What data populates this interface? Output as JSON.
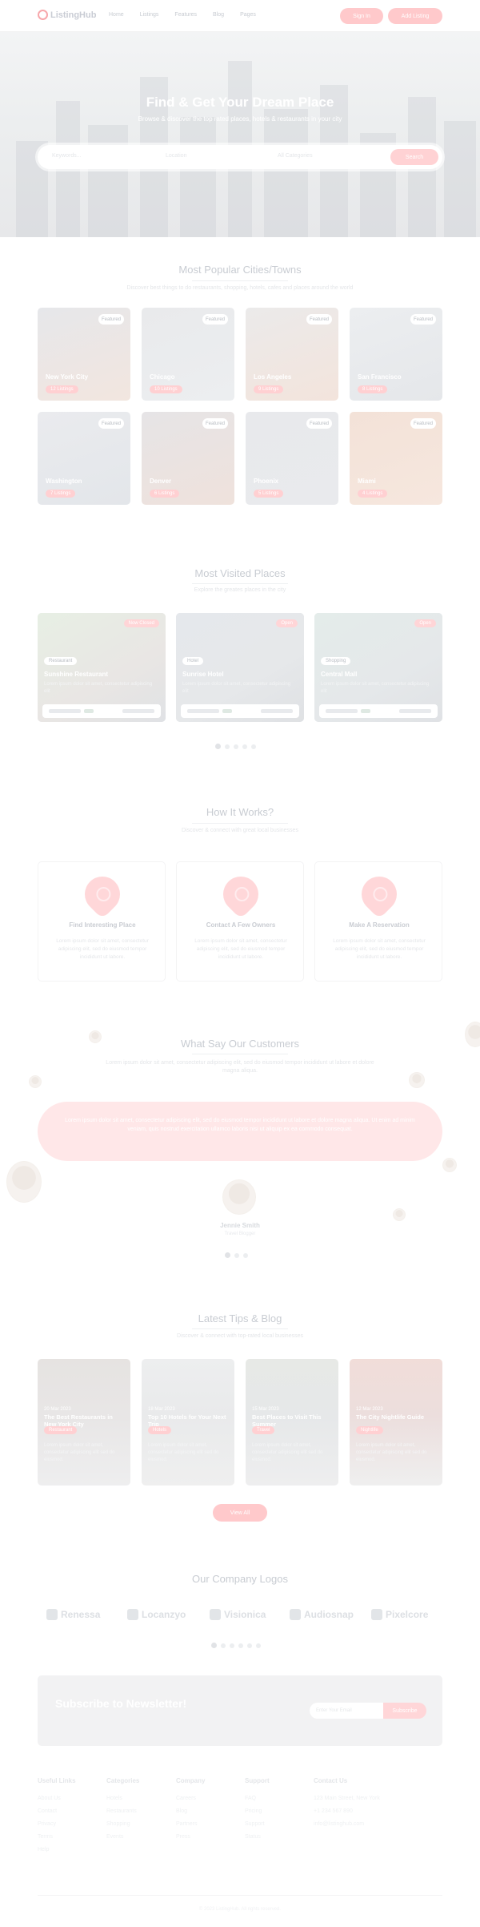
{
  "header": {
    "logo_text": "ListingHub",
    "nav": [
      "Home",
      "Listings",
      "Features",
      "Blog",
      "Pages"
    ],
    "signin_label": "Sign In",
    "add_listing_label": "Add Listing"
  },
  "hero": {
    "title": "Find & Get Your Dream Place",
    "subtitle": "Browse & discover the top rated places, hotels & restaurants in your city",
    "search": {
      "keyword_placeholder": "Keywords...",
      "location_placeholder": "Location",
      "category_placeholder": "All Categories",
      "button_label": "Search"
    }
  },
  "popular_cities": {
    "title": "Most Popular Cities/Towns",
    "subtitle": "Discover best things to do restaurants, shopping, hotels, cafes and places around the world",
    "cities": [
      {
        "name": "New York City",
        "tag": "12 Listings",
        "badge": "Featured"
      },
      {
        "name": "Chicago",
        "tag": "10 Listings",
        "badge": "Featured"
      },
      {
        "name": "Los Angeles",
        "tag": "9 Listings",
        "badge": "Featured"
      },
      {
        "name": "San Francisco",
        "tag": "8 Listings",
        "badge": "Featured"
      },
      {
        "name": "Washington",
        "tag": "7 Listings",
        "badge": "Featured"
      },
      {
        "name": "Denver",
        "tag": "6 Listings",
        "badge": "Featured"
      },
      {
        "name": "Phoenix",
        "tag": "5 Listings",
        "badge": "Featured"
      },
      {
        "name": "Miami",
        "tag": "4 Listings",
        "badge": "Featured"
      }
    ]
  },
  "most_visited": {
    "title": "Most Visited Places",
    "subtitle": "Explore the greates places in the city",
    "places": [
      {
        "badge": "Now Closed",
        "category": "Restaurant",
        "name": "Sunshine Restaurant",
        "desc": "Lorem ipsum dolor sit amet, consectetur adipiscing elit"
      },
      {
        "badge": "Open",
        "category": "Hotel",
        "name": "Sunrise Hotel",
        "desc": "Lorem ipsum dolor sit amet, consectetur adipiscing elit"
      },
      {
        "badge": "Open",
        "category": "Shopping",
        "name": "Central Mall",
        "desc": "Lorem ipsum dolor sit amet, consectetur adipiscing elit"
      }
    ]
  },
  "how_it_works": {
    "title": "How It Works?",
    "subtitle": "Discover & connect with great local businesses",
    "steps": [
      {
        "title": "Find Interesting Place",
        "desc": "Lorem ipsum dolor sit amet, consectetur adipiscing elit, sed do eiusmod tempor incididunt ut labore."
      },
      {
        "title": "Contact A Few Owners",
        "desc": "Lorem ipsum dolor sit amet, consectetur adipiscing elit, sed do eiusmod tempor incididunt ut labore."
      },
      {
        "title": "Make A Reservation",
        "desc": "Lorem ipsum dolor sit amet, consectetur adipiscing elit, sed do eiusmod tempor incididunt ut labore."
      }
    ]
  },
  "testimonials": {
    "title": "What Say Our Customers",
    "subtitle": "Lorem ipsum dolor sit amet, consectetur adipiscing elit, sed do eiusmod tempor incididunt ut labore et dolore magna aliqua.",
    "quote": "Lorem ipsum dolor sit amet, consectetur adipiscing elit, sed do eiusmod tempor incididunt ut labore et dolore magna aliqua. Ut enim ad minim veniam, quis nostrud exercitation ullamco laboris nisi ut aliquip ex ea commodo consequat.",
    "author": "Jennie Smith",
    "role": "Travel Blogger"
  },
  "blog": {
    "title": "Latest Tips & Blog",
    "subtitle": "Discover & connect with top-rated local businesses",
    "posts": [
      {
        "date": "20 Mar 2023",
        "title": "The Best Restaurants in New York City",
        "tag": "Restaurant",
        "desc": "Lorem ipsum dolor sit amet, consectetur adipiscing elit sed do eiusmod."
      },
      {
        "date": "18 Mar 2023",
        "title": "Top 10 Hotels for Your Next Trip",
        "tag": "Hotels",
        "desc": "Lorem ipsum dolor sit amet, consectetur adipiscing elit sed do eiusmod."
      },
      {
        "date": "15 Mar 2023",
        "title": "Best Places to Visit This Summer",
        "tag": "Travel",
        "desc": "Lorem ipsum dolor sit amet, consectetur adipiscing elit sed do eiusmod."
      },
      {
        "date": "12 Mar 2023",
        "title": "The City Nightlife Guide",
        "tag": "Nightlife",
        "desc": "Lorem ipsum dolor sit amet, consectetur adipiscing elit sed do eiusmod."
      }
    ],
    "view_all_label": "View All"
  },
  "company_logos": {
    "title": "Our Company Logos",
    "logos": [
      "Renessa",
      "Locanzyo",
      "Visionica",
      "Audiosnap",
      "Pixelcore"
    ]
  },
  "newsletter": {
    "title": "Subscribe to Newsletter!",
    "input_placeholder": "Enter Your Email",
    "button_label": "Subscribe"
  },
  "footer": {
    "columns": [
      {
        "title": "Useful Links",
        "links": [
          "About Us",
          "Contact",
          "Privacy",
          "Terms",
          "Help"
        ]
      },
      {
        "title": "Categories",
        "links": [
          "Hotels",
          "Restaurants",
          "Shopping",
          "Events"
        ]
      },
      {
        "title": "Company",
        "links": [
          "Careers",
          "Blog",
          "Partners",
          "Press"
        ]
      },
      {
        "title": "Support",
        "links": [
          "FAQ",
          "Pricing",
          "Support",
          "Status"
        ]
      },
      {
        "title": "Contact Us",
        "links": [
          "123 Main Street, New York",
          "+1 234 567 890",
          "info@listinghub.com"
        ]
      }
    ],
    "copyright": "© 2023 ListingHub. All rights reserved."
  }
}
